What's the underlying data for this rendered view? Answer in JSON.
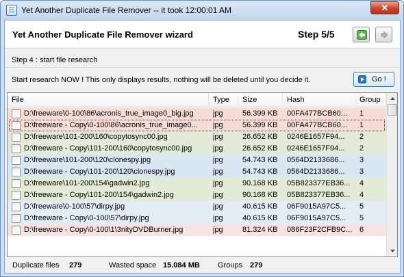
{
  "window": {
    "title": "Yet Another Duplicate File Remover -- it took 12:00:01 AM",
    "close_label": "✕"
  },
  "wizard": {
    "title": "Yet Another Duplicate File Remover wizard",
    "step": "Step 5/5",
    "back_icon": "green-left-arrow-icon",
    "forward_icon": "gray-right-arrow-icon",
    "accent": "#3fae3f"
  },
  "step_caption": "Step 4 : start file research",
  "instruction": "Start research NOW ! This only displays results, nothing will be deleted until you decide it.",
  "go_button": {
    "label": "Go !",
    "icon": "play-arrow-icon"
  },
  "table": {
    "columns": [
      "File",
      "Type",
      "Size",
      "Hash",
      "Group"
    ],
    "group_colors": {
      "1": "#f8ddd7",
      "2": "#e3ead8",
      "3": "#d9e6f4",
      "4": "#e2ebd6",
      "5": "#e3edf6",
      "6": "#f6e3e2"
    },
    "rows": [
      {
        "file": "D:\\freeware\\0-100\\86\\acronis_true_image0_big.jpg",
        "type": "jpg",
        "size": "56.399 KB",
        "hash": "00FA477BCB60...",
        "group": "1",
        "checked": false
      },
      {
        "file": "D:\\freeware - Copy\\0-100\\86\\acronis_true_image0...",
        "type": "jpg",
        "size": "56.399 KB",
        "hash": "00FA477BCB60...",
        "group": "1",
        "checked": false,
        "focused": true
      },
      {
        "file": "D:\\freeware\\101-200\\160\\copytosync00.jpg",
        "type": "jpg",
        "size": "26.652 KB",
        "hash": "0246E1657F94...",
        "group": "2",
        "checked": false
      },
      {
        "file": "D:\\freeware - Copy\\101-200\\160\\copytosync00.jpg",
        "type": "jpg",
        "size": "26.652 KB",
        "hash": "0246E1657F94...",
        "group": "2",
        "checked": false
      },
      {
        "file": "D:\\freeware\\101-200\\120\\clonespy.jpg",
        "type": "jpg",
        "size": "54.743 KB",
        "hash": "0564D2133686...",
        "group": "3",
        "checked": false
      },
      {
        "file": "D:\\freeware - Copy\\101-200\\120\\clonespy.jpg",
        "type": "jpg",
        "size": "54.743 KB",
        "hash": "0564D2133686...",
        "group": "3",
        "checked": false
      },
      {
        "file": "D:\\freeware\\101-200\\154\\gadwin2.jpg",
        "type": "jpg",
        "size": "90.168 KB",
        "hash": "05B823377EB36...",
        "group": "4",
        "checked": false
      },
      {
        "file": "D:\\freeware - Copy\\101-200\\154\\gadwin2.jpg",
        "type": "jpg",
        "size": "90.168 KB",
        "hash": "05B823377EB36...",
        "group": "4",
        "checked": false
      },
      {
        "file": "D:\\freeware\\0-100\\57\\dirpy.jpg",
        "type": "jpg",
        "size": "40.615 KB",
        "hash": "06F9015A97C5...",
        "group": "5",
        "checked": false
      },
      {
        "file": "D:\\freeware - Copy\\0-100\\57\\dirpy.jpg",
        "type": "jpg",
        "size": "40.615 KB",
        "hash": "06F9015A97C5...",
        "group": "5",
        "checked": false
      },
      {
        "file": "D:\\freeware - Copy\\0-100\\1\\3nityDVDBurner.jpg",
        "type": "jpg",
        "size": "81.324 KB",
        "hash": "086F23F2CFB9C...",
        "group": "6",
        "checked": false
      }
    ]
  },
  "status": {
    "duplicate_files_label": "Duplicate files",
    "duplicate_files_value": "279",
    "wasted_space_label": "Wasted space",
    "wasted_space_value": "15.084 MB",
    "groups_label": "Groups",
    "groups_value": "279"
  }
}
